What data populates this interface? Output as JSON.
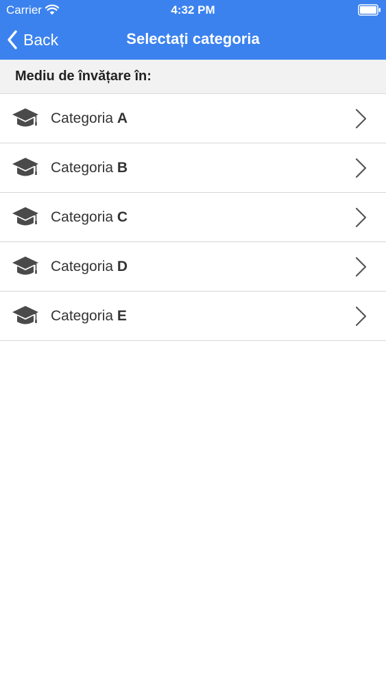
{
  "status_bar": {
    "carrier": "Carrier",
    "time": "4:32 PM",
    "icons": [
      "wifi-icon",
      "battery-icon"
    ]
  },
  "nav_bar": {
    "back_label": "Back",
    "title": "Selectați categoria",
    "back_icon": "chevron-left-icon"
  },
  "section": {
    "title": "Mediu de învățare în:"
  },
  "categories": [
    {
      "prefix": "Categoria",
      "letter": "A",
      "icon": "graduation-cap-icon"
    },
    {
      "prefix": "Categoria",
      "letter": "B",
      "icon": "graduation-cap-icon"
    },
    {
      "prefix": "Categoria",
      "letter": "C",
      "icon": "graduation-cap-icon"
    },
    {
      "prefix": "Categoria",
      "letter": "D",
      "icon": "graduation-cap-icon"
    },
    {
      "prefix": "Categoria",
      "letter": "E",
      "icon": "graduation-cap-icon"
    }
  ],
  "colors": {
    "accent": "#3b82ee",
    "icon": "#4a4a4a",
    "chevron": "#555555"
  }
}
